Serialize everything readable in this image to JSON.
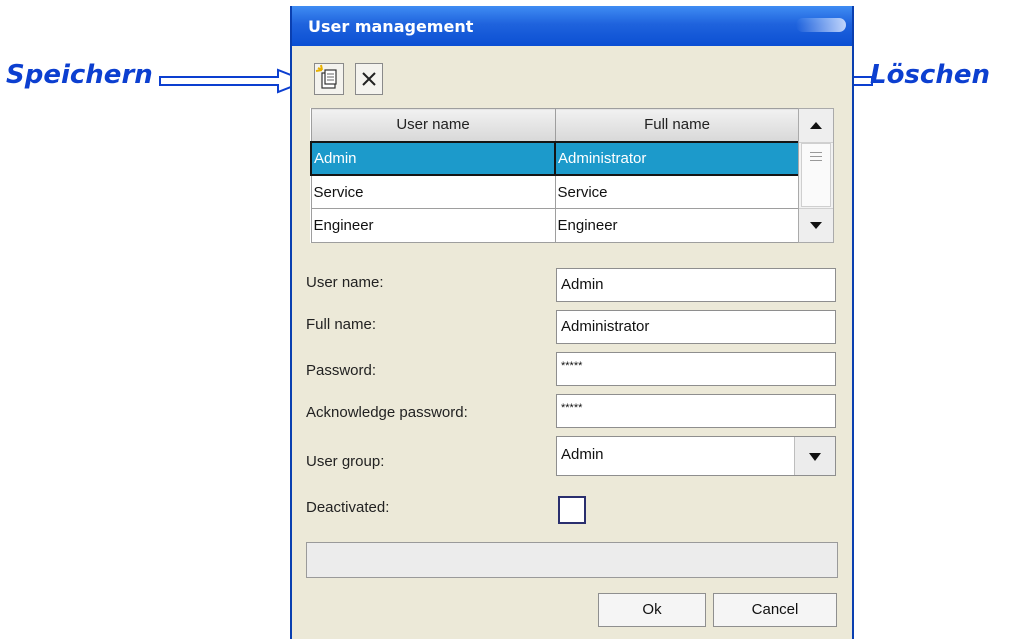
{
  "annotations": {
    "save_label": "Speichern",
    "delete_label": "Löschen"
  },
  "window": {
    "title": "User management"
  },
  "toolbar": {
    "new_icon": "new-document-icon",
    "delete_icon": "delete-x-icon"
  },
  "table": {
    "columns": [
      "User name",
      "Full name"
    ],
    "rows": [
      {
        "user": "Admin",
        "full": "Administrator",
        "selected": true
      },
      {
        "user": "Service",
        "full": "Service",
        "selected": false
      },
      {
        "user": "Engineer",
        "full": "Engineer",
        "selected": false
      }
    ]
  },
  "form": {
    "user_name_label": "User name:",
    "user_name_value": "Admin",
    "full_name_label": "Full name:",
    "full_name_value": "Administrator",
    "password_label": "Password:",
    "password_value": "*****",
    "ack_password_label": "Acknowledge password:",
    "ack_password_value": "*****",
    "user_group_label": "User group:",
    "user_group_value": "Admin",
    "deactivated_label": "Deactivated:",
    "deactivated_checked": false
  },
  "buttons": {
    "ok": "Ok",
    "cancel": "Cancel"
  },
  "colors": {
    "annotation": "#0c3fd0",
    "titlebar": "#1f63dd",
    "selection": "#1c9acb"
  }
}
